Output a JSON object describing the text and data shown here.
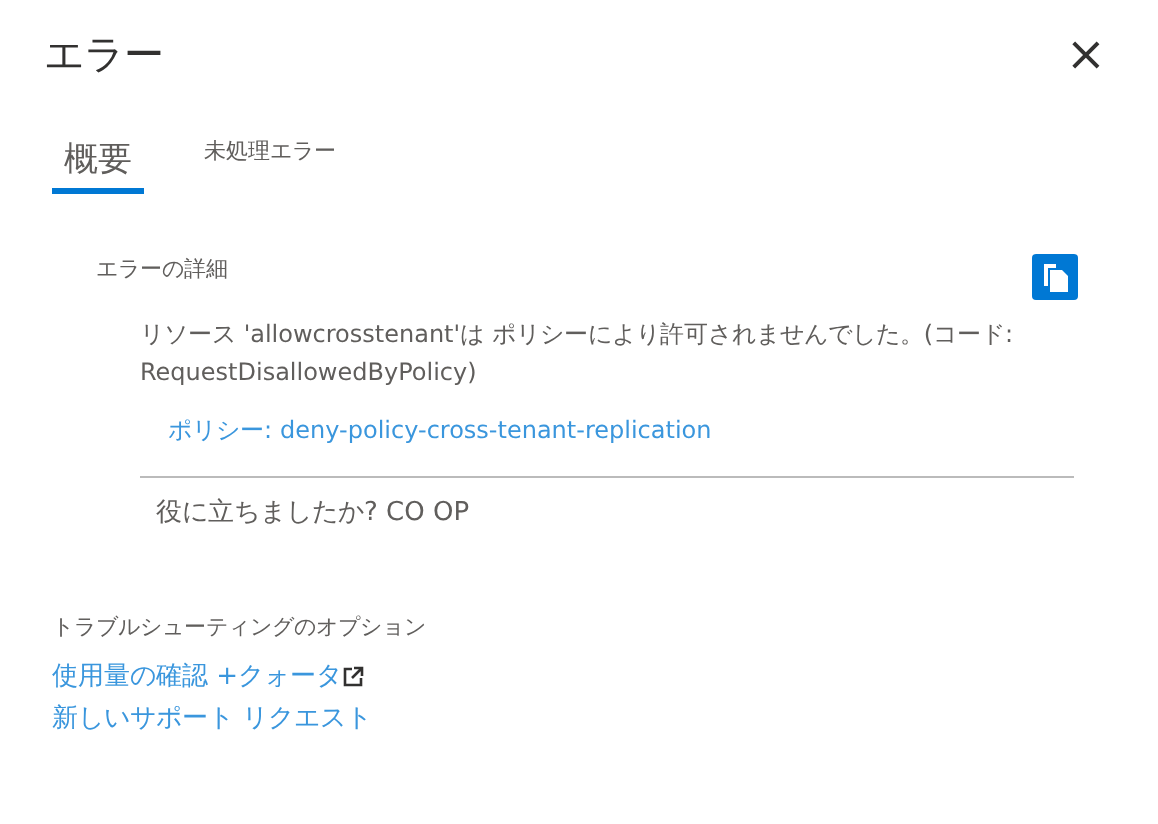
{
  "window": {
    "title": "エラー",
    "close": "×"
  },
  "tabs": [
    {
      "label": "概要",
      "selected": true
    },
    {
      "label": "未処理エラー",
      "selected": false
    }
  ],
  "details": {
    "heading": "エラーの詳細",
    "message": "リソース 'allowcrosstenant'は ポリシーにより許可されませんでした。(コード: RequestDisallowedByPolicy)",
    "policy_label": "ポリシー:",
    "policy_link": "deny-policy-cross-tenant-replication",
    "feedback": "役に立ちましたか? CO OP"
  },
  "troubleshooting": {
    "heading": "トラブルシューティングのオプション",
    "links": [
      {
        "label": "使用量の確認 +クォータ",
        "external": true
      },
      {
        "label": "新しいサポート リクエスト",
        "external": false
      }
    ]
  }
}
